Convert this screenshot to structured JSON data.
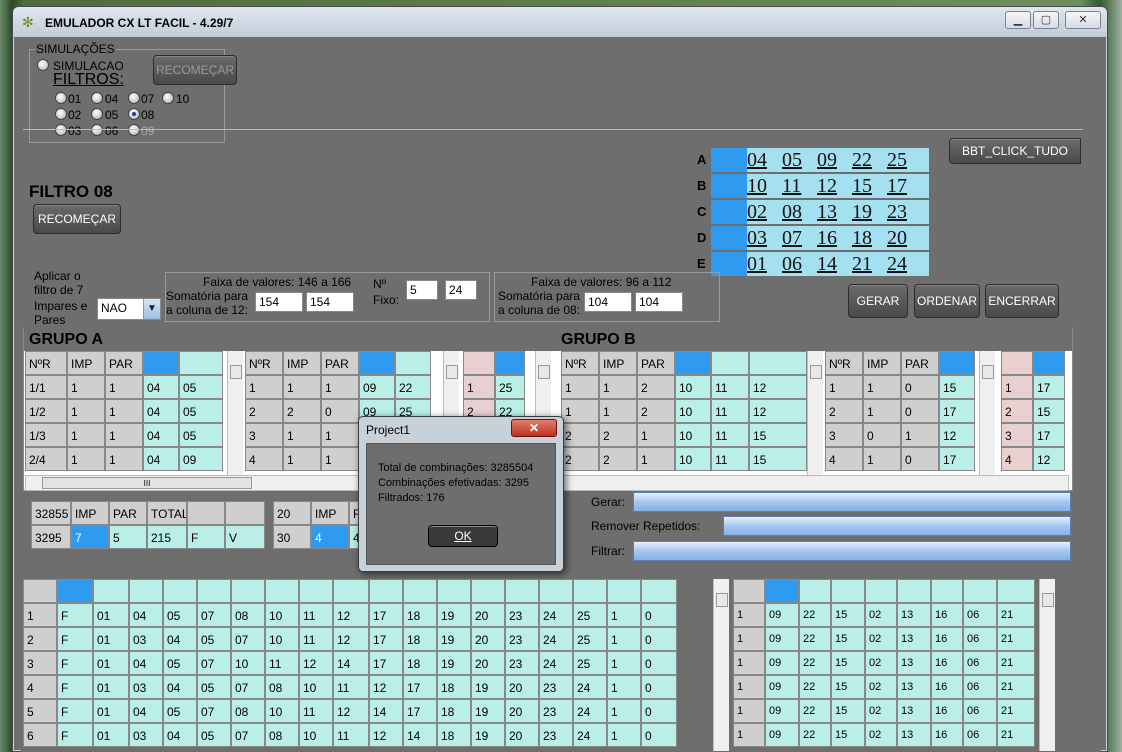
{
  "window": {
    "title": "EMULADOR CX LT FACIL - 4.29/7",
    "min": "▁",
    "max": "▢",
    "close": "✕"
  },
  "sim": {
    "group": "SIMULAÇÕES",
    "radio": "SIMULACAO",
    "restart": "RECOMEÇAR",
    "filters_title": "FILTROS:",
    "filters": [
      "01",
      "04",
      "07",
      "10",
      "02",
      "05",
      "08",
      "03",
      "06",
      "09"
    ],
    "selected": "08"
  },
  "filtro": {
    "title": "FILTRO 08",
    "restart": "RECOMEÇAR"
  },
  "letters": [
    {
      "label": "A",
      "nums": [
        "04",
        "05",
        "09",
        "22",
        "25"
      ]
    },
    {
      "label": "B",
      "nums": [
        "10",
        "11",
        "12",
        "15",
        "17"
      ]
    },
    {
      "label": "C",
      "nums": [
        "02",
        "08",
        "13",
        "19",
        "23"
      ]
    },
    {
      "label": "D",
      "nums": [
        "03",
        "07",
        "16",
        "18",
        "20"
      ]
    },
    {
      "label": "E",
      "nums": [
        "01",
        "06",
        "14",
        "21",
        "24"
      ]
    }
  ],
  "bbt": "BBT_CLICK_TUDO",
  "apply": {
    "text1": "Aplicar o",
    "text2": "filtro de 7",
    "text3": "Impares  e",
    "text4": "Pares",
    "select": "NAO"
  },
  "faixa1": {
    "title": "Faixa de valores: 146 a 166",
    "som1": "Somatória para",
    "som2": "a coluna de 12:",
    "v1": "154",
    "v2": "154",
    "nlabel": "Nº",
    "fixo": "Fixo:",
    "n1": "5",
    "n2": "24"
  },
  "faixa2": {
    "title": "Faixa de valores: 96 a 112",
    "som1": "Somatória para",
    "som2": "a coluna de 08:",
    "v1": "104",
    "v2": "104"
  },
  "actions": {
    "gerar": "GERAR",
    "ordenar": "ORDENAR",
    "encerrar": "ENCERRAR"
  },
  "grupoA": {
    "title": "GRUPO A",
    "headers": [
      "NºR",
      "IMP",
      "PAR"
    ],
    "t1": [
      [
        "1/1",
        "1",
        "1",
        "04",
        "05"
      ],
      [
        "1/2",
        "1",
        "1",
        "04",
        "05"
      ],
      [
        "1/3",
        "1",
        "1",
        "04",
        "05"
      ],
      [
        "2/4",
        "1",
        "1",
        "04",
        "09"
      ]
    ],
    "t2": [
      [
        "1",
        "1",
        "1",
        "09",
        "22"
      ],
      [
        "2",
        "2",
        "0",
        "09",
        "25"
      ],
      [
        "3",
        "1",
        "1",
        "",
        ""
      ],
      [
        "4",
        "1",
        "1",
        "",
        ""
      ]
    ],
    "t3": [
      [
        "1",
        "25"
      ],
      [
        "2",
        "22"
      ]
    ]
  },
  "grupoB": {
    "title": "GRUPO B",
    "headers": [
      "NºR",
      "IMP",
      "PAR"
    ],
    "t1": [
      [
        "1",
        "1",
        "2",
        "10",
        "11",
        "12"
      ],
      [
        "1",
        "1",
        "2",
        "10",
        "11",
        "12"
      ],
      [
        "2",
        "2",
        "1",
        "10",
        "11",
        "15"
      ],
      [
        "2",
        "2",
        "1",
        "10",
        "11",
        "15"
      ]
    ],
    "t2": [
      [
        "1",
        "1",
        "0",
        "15"
      ],
      [
        "2",
        "1",
        "0",
        "17"
      ],
      [
        "3",
        "0",
        "1",
        "12"
      ],
      [
        "4",
        "1",
        "0",
        "17"
      ]
    ],
    "t3": [
      [
        "1",
        "17"
      ],
      [
        "2",
        "15"
      ],
      [
        "3",
        "17"
      ],
      [
        "4",
        "12"
      ]
    ]
  },
  "sumA": {
    "h": [
      "32855",
      "IMP",
      "PAR",
      "TOTAL",
      "",
      ""
    ],
    "r": [
      "3295",
      "7",
      "5",
      "215",
      "F",
      "V"
    ]
  },
  "sumB": {
    "h": [
      "20",
      "IMP",
      "F"
    ],
    "r": [
      "30",
      "4",
      "4"
    ]
  },
  "progress": {
    "gerar": "Gerar:",
    "remover": "Remover Repetidos:",
    "filtrar": "Filtrar:"
  },
  "dialog": {
    "title": "Project1",
    "l1": "Total de combinações:  3285504",
    "l2": "Combinações efetivadas:  3295",
    "l3": "Filtrados:  176",
    "ok": "OK",
    "close": "✕"
  },
  "big": {
    "rows": [
      [
        "1",
        "F",
        "01",
        "04",
        "05",
        "07",
        "08",
        "10",
        "11",
        "12",
        "17",
        "18",
        "19",
        "20",
        "23",
        "24",
        "25",
        "1",
        "0"
      ],
      [
        "2",
        "F",
        "01",
        "03",
        "04",
        "05",
        "07",
        "10",
        "11",
        "12",
        "17",
        "18",
        "19",
        "20",
        "23",
        "24",
        "25",
        "1",
        "0"
      ],
      [
        "3",
        "F",
        "01",
        "04",
        "05",
        "07",
        "10",
        "11",
        "12",
        "14",
        "17",
        "18",
        "19",
        "20",
        "23",
        "24",
        "25",
        "1",
        "0"
      ],
      [
        "4",
        "F",
        "01",
        "03",
        "04",
        "05",
        "07",
        "08",
        "10",
        "11",
        "12",
        "17",
        "18",
        "19",
        "20",
        "23",
        "24",
        "1",
        "0"
      ],
      [
        "5",
        "F",
        "01",
        "04",
        "05",
        "07",
        "08",
        "10",
        "11",
        "12",
        "14",
        "17",
        "18",
        "19",
        "20",
        "23",
        "24",
        "1",
        "0"
      ],
      [
        "6",
        "F",
        "01",
        "03",
        "04",
        "05",
        "07",
        "08",
        "10",
        "11",
        "12",
        "14",
        "18",
        "19",
        "20",
        "23",
        "24",
        "1",
        "0"
      ]
    ]
  },
  "right": {
    "rows": [
      [
        "1",
        "09",
        "22",
        "15",
        "02",
        "13",
        "16",
        "06",
        "21"
      ],
      [
        "1",
        "09",
        "22",
        "15",
        "02",
        "13",
        "16",
        "06",
        "21"
      ],
      [
        "1",
        "09",
        "22",
        "15",
        "02",
        "13",
        "16",
        "06",
        "21"
      ],
      [
        "1",
        "09",
        "22",
        "15",
        "02",
        "13",
        "16",
        "06",
        "21"
      ],
      [
        "1",
        "09",
        "22",
        "15",
        "02",
        "13",
        "16",
        "06",
        "21"
      ],
      [
        "1",
        "09",
        "22",
        "15",
        "02",
        "13",
        "16",
        "06",
        "21"
      ]
    ]
  },
  "scroll_thumb": "III"
}
